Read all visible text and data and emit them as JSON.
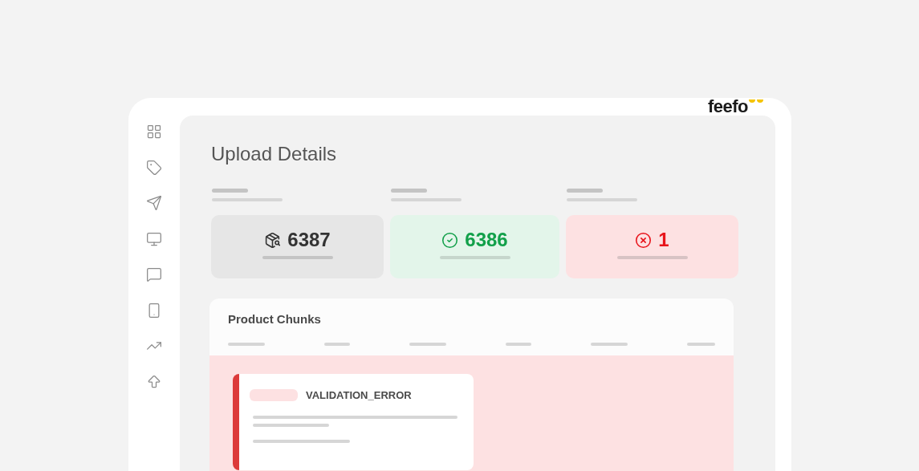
{
  "logo": {
    "text": "feefo"
  },
  "page": {
    "title": "Upload Details"
  },
  "stats": [
    {
      "kind": "total",
      "value": "6387"
    },
    {
      "kind": "success",
      "value": "6386"
    },
    {
      "kind": "error",
      "value": "1"
    }
  ],
  "chunks": {
    "title": "Product Chunks",
    "error_card": {
      "code": "VALIDATION_ERROR"
    }
  }
}
